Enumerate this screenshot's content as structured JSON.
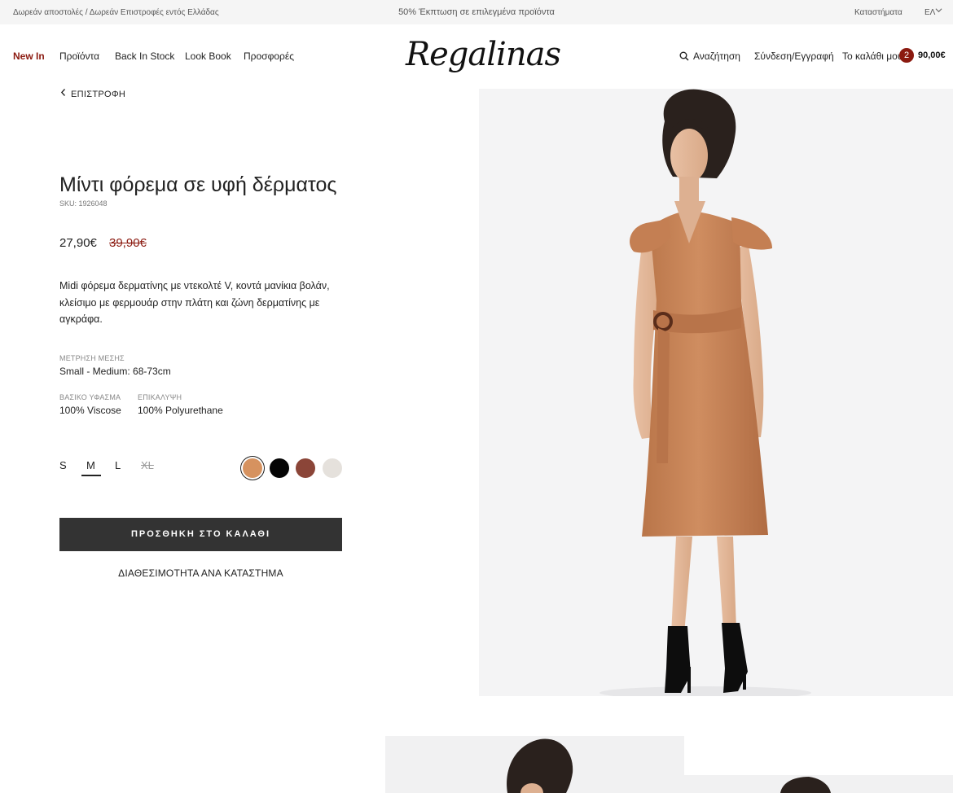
{
  "announcement": {
    "shipping": "Δωρεάν αποστολές / Δωρεάν Επιστροφές εντός Ελλάδας",
    "promo": "50% Έκπτωση σε επιλεγμένα προϊόντα",
    "stores": "Καταστήματα",
    "language": "ΕΛ"
  },
  "header": {
    "logo": "Regalinas",
    "nav": [
      "New In",
      "Προϊόντα",
      "Back In Stock",
      "Look Book",
      "Προσφορές"
    ],
    "search": "Αναζήτηση",
    "account": "Σύνδεση/Εγγραφή",
    "cart_label": "Το καλάθι μου",
    "cart_count": "2",
    "cart_total": "90,00€"
  },
  "back": "ΕΠΙΣΤΡΟΦΗ",
  "product": {
    "title": "Μίντι φόρεμα σε υφή δέρματος",
    "sku": "SKU: 1926048",
    "price": "27,90€",
    "old_price": "39,90€",
    "description": "Midi φόρεμα δερματίνης με ντεκολτέ V, κοντά μανίκια βολάν, κλείσιμο με φερμουάρ στην πλάτη και ζώνη δερματίνης με αγκράφα.",
    "waist_label": "ΜΕΤΡΗΣΗ ΜΕΣΗΣ",
    "waist_value": "Small - Medium: 68-73cm",
    "fabric_label": "ΒΑΣΙΚΟ ΥΦΑΣΜΑ",
    "fabric_value": "100% Viscose",
    "coating_label": "ΕΠΙΚΑΛΥΨΗ",
    "coating_value": "100% Polyurethane",
    "sizes": [
      "S",
      "M",
      "L",
      "XL"
    ],
    "selected_size": "M",
    "unavailable_size": "XL",
    "colors": [
      "#d6925f",
      "#050505",
      "#8b4538",
      "#e5e1dc"
    ],
    "selected_color": "#d6925f",
    "add_to_cart": "ΠΡΟΣΘΗΚΗ ΣΤΟ ΚΑΛΑΘΙ",
    "availability": "ΔΙΑΘΕΣΙΜΟΤΗΤΑ ΑΝΑ ΚΑΤΑΣΤΗΜΑ"
  },
  "colors": {
    "accent": "#8b1a10",
    "button": "#333333",
    "dress": "#c8845a"
  }
}
